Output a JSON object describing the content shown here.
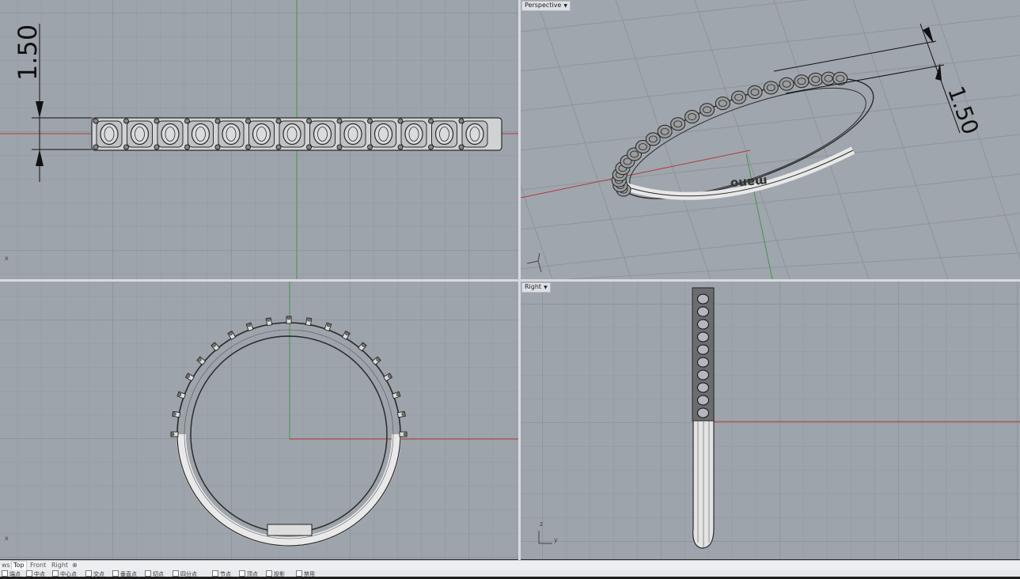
{
  "viewports": {
    "top": {
      "dimension_label": "1.50"
    },
    "perspective": {
      "label": "Perspective",
      "dimension_label": "1.50",
      "engraving": "mano"
    },
    "front": {
      "label": ""
    },
    "right": {
      "label": "Right"
    }
  },
  "axis_labels": {
    "x": "x",
    "y": "y",
    "z": "z"
  },
  "tabs": [
    {
      "label": "ws",
      "active": false
    },
    {
      "label": "Top",
      "active": true
    },
    {
      "label": "Front",
      "active": false
    },
    {
      "label": "Right",
      "active": false
    },
    {
      "label": "⊕",
      "active": false
    }
  ],
  "osnaps": [
    "端点",
    "中点",
    "中心点",
    "交点",
    "垂直点",
    "切点",
    "四分点",
    "节点",
    "顶点",
    "投影",
    "禁用"
  ],
  "colors": {
    "viewport_bg": "#9ea4ab",
    "x_axis": "#b03a3a",
    "y_axis": "#3d9a3d",
    "wire": "#2b2b2b"
  }
}
